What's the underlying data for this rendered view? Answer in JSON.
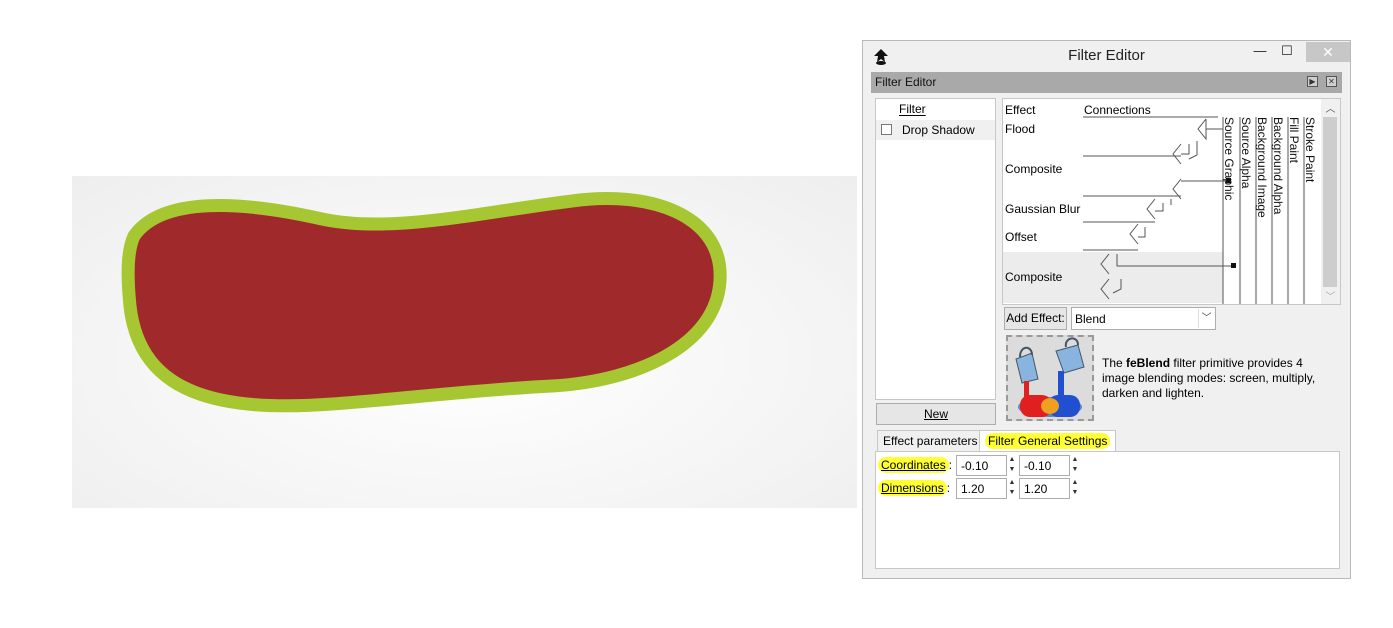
{
  "window": {
    "title": "Filter Editor",
    "close_label": "✕",
    "min_label": "—",
    "max_label": "☐"
  },
  "dock": {
    "label": "Filter Editor"
  },
  "filter_list": {
    "header": "Filter",
    "items": [
      {
        "name": "Drop Shadow",
        "checked": false
      }
    ],
    "new_button": "New"
  },
  "effects": {
    "headers": {
      "effect": "Effect",
      "connections": "Connections"
    },
    "rows": [
      "Flood",
      "Composite",
      "Gaussian Blur",
      "Offset",
      "Composite"
    ],
    "inputs": [
      "Source Graphic",
      "Source Alpha",
      "Background Image",
      "Background Alpha",
      "Fill Paint",
      "Stroke Paint"
    ]
  },
  "add_effect": {
    "button": "Add Effect:",
    "selected": "Blend"
  },
  "description": {
    "prefix": "The ",
    "bold": "feBlend",
    "suffix": " filter primitive provides 4 image blending modes: screen, multiply, darken and lighten."
  },
  "tabs": [
    "Effect parameters",
    "Filter General Settings"
  ],
  "settings": {
    "coordinates_label": "Coordinates",
    "dimensions_label": "Dimensions",
    "colon": ":",
    "coordinates": [
      "-0.10",
      "-0.10"
    ],
    "dimensions": [
      "1.20",
      "1.20"
    ]
  },
  "colors": {
    "shape_fill": "#a0292b",
    "shape_stroke": "#a6c632",
    "highlight": "#ffff33",
    "dock_bar": "#a9a9a9"
  }
}
